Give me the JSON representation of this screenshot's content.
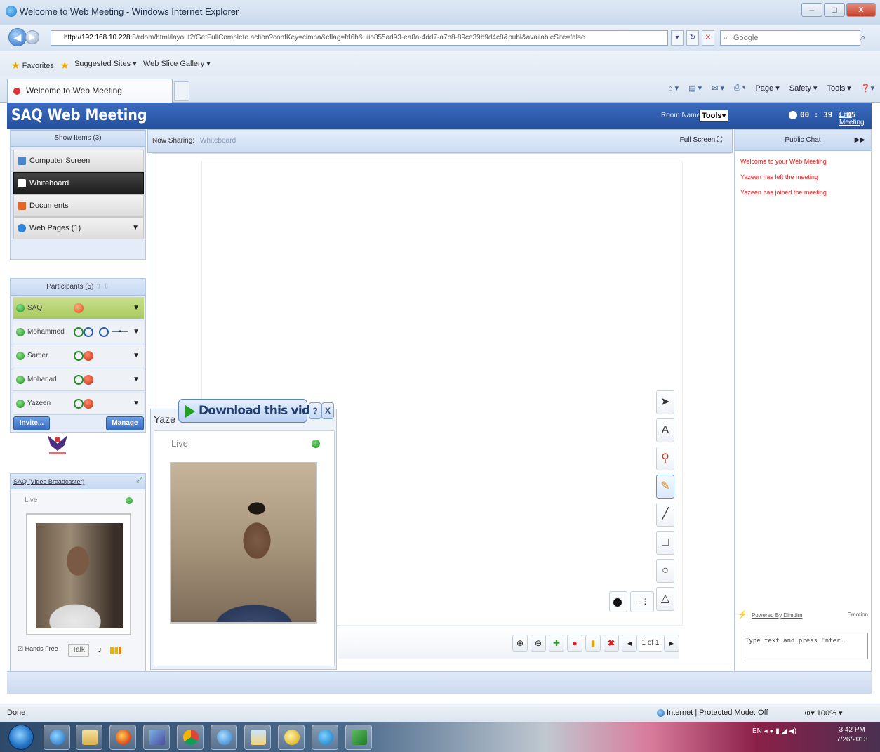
{
  "browser": {
    "window_title": "Welcome to Web Meeting - Windows Internet Explorer",
    "address_host": "http://192.168.10.228",
    "address_path": ":8/rdom/html/layout2/GetFullComplete.action?confKey=cimna&cflag=fd6b&uiio855ad93-ea8a-4dd7-a7b8-89ce39b9d4c8&publ&availableSite=false",
    "search_placeholder": "Google",
    "favorites_label": "Favorites",
    "suggested_sites_label": "Suggested Sites ▾",
    "web_slice_label": "Web Slice Gallery ▾",
    "tab_title": "Welcome to Web Meeting",
    "cmd_page": "Page ▾",
    "cmd_safety": "Safety ▾",
    "cmd_tools": "Tools ▾",
    "status": "Done",
    "zone": "Internet | Protected Mode: Off",
    "zoom": "100%"
  },
  "app": {
    "title": "SAQ Web Meeting",
    "room_name_label": "Room Name",
    "tools_label": "Tools",
    "timer": "00 : 39 : 05",
    "end_meeting": "End Meeting"
  },
  "share": {
    "header": "Show Items (3)",
    "items": [
      {
        "label": "Computer Screen",
        "color": "#4c86c9"
      },
      {
        "label": "Whiteboard",
        "color": "#ffffff"
      },
      {
        "label": "Documents",
        "color": "#e0682a"
      },
      {
        "label": "Web Pages (1)",
        "color": "#2e86d9"
      }
    ]
  },
  "participants": {
    "header": "Participants (5)",
    "list": [
      {
        "name": "SAQ"
      },
      {
        "name": "Mohammed"
      },
      {
        "name": "Samer"
      },
      {
        "name": "Mohanad"
      },
      {
        "name": "Yazeen"
      }
    ],
    "invite_label": "Invite...",
    "manage_label": "Manage"
  },
  "broadcaster": {
    "title": "SAQ (Video Broadcaster)",
    "live": "Live",
    "hands_free": "Hands Free",
    "talk": "Talk"
  },
  "stage": {
    "now_sharing_label": "Now Sharing:",
    "now_sharing_value": "Whiteboard",
    "full_screen": "Full Screen",
    "page_indicator": "1 of 1"
  },
  "video_popup": {
    "title": "Yaze",
    "download_label": "Download this video",
    "help": "?",
    "close": "X",
    "live": "Live"
  },
  "chat": {
    "header": "Public Chat",
    "messages": [
      "Welcome to your Web Meeting",
      "Yazeen has left the meeting",
      "Yazeen has joined the meeting"
    ],
    "powered_by": "Powered By Dimdim",
    "emotion": "Emotion",
    "input_placeholder": "Type text and press Enter."
  },
  "taskbar": {
    "time": "3:42 PM",
    "date": "7/26/2013"
  }
}
